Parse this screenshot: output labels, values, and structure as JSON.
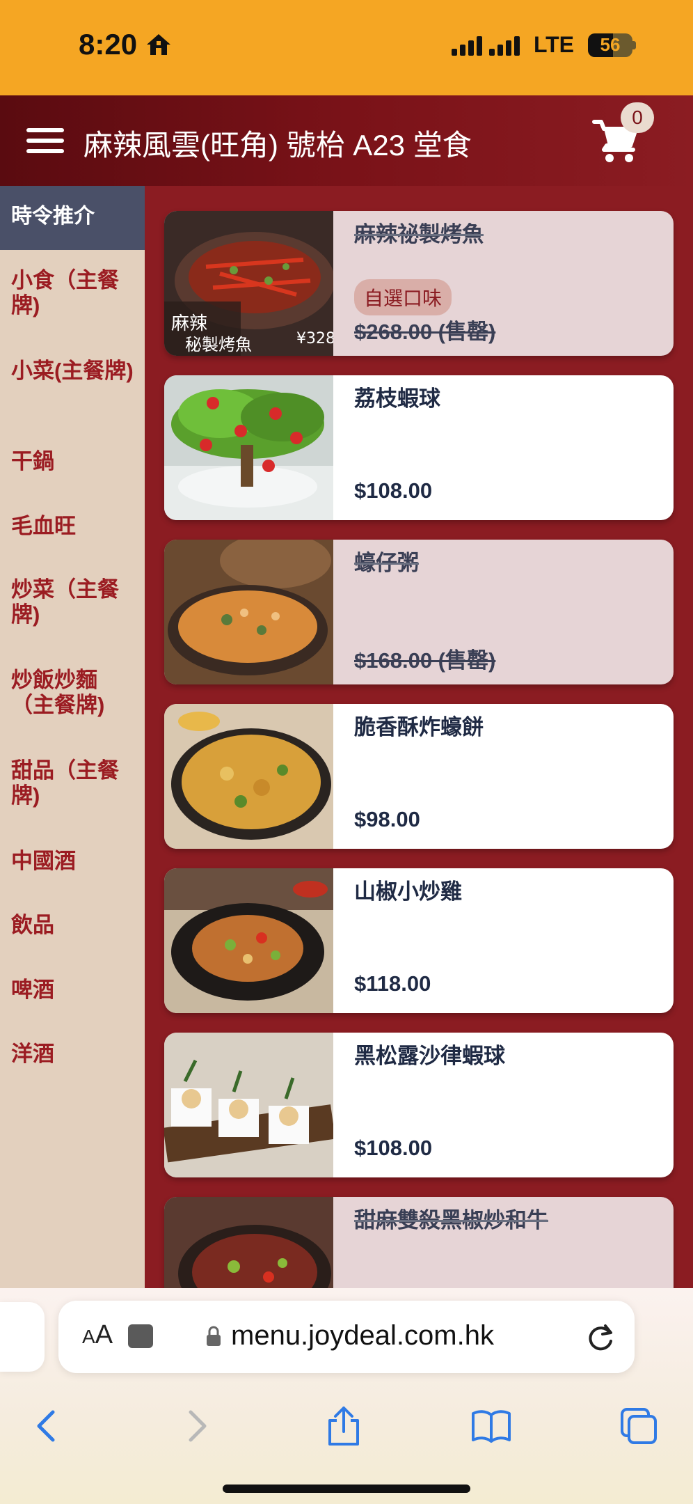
{
  "status_bar": {
    "time": "8:20",
    "network": "LTE",
    "battery": "56",
    "icons": [
      "home-icon",
      "signal-icon",
      "battery-icon"
    ]
  },
  "header": {
    "title": "麻辣風雲(旺角) 號枱 A23 堂食",
    "cart_count": "0",
    "icons": [
      "menu-icon",
      "cart-icon"
    ]
  },
  "sidebar": {
    "items": [
      {
        "label": "時令推介"
      },
      {
        "label": "小食（主餐牌)"
      },
      {
        "label": "小菜(主餐牌)"
      },
      {
        "label": "干鍋"
      },
      {
        "label": "毛血旺"
      },
      {
        "label": "炒菜（主餐牌)"
      },
      {
        "label": "炒飯炒麵（主餐牌)"
      },
      {
        "label": "甜品（主餐牌)"
      },
      {
        "label": "中國酒"
      },
      {
        "label": "飲品"
      },
      {
        "label": "啤酒"
      },
      {
        "label": "洋酒"
      }
    ]
  },
  "menu": {
    "items": [
      {
        "name": "麻辣祕製烤魚",
        "price": "$268.00 (售罄)",
        "tag": "自選口味",
        "sold_out": true
      },
      {
        "name": "荔枝蝦球",
        "price": "$108.00",
        "sold_out": false
      },
      {
        "name": "蠔仔粥",
        "price": "$168.00 (售罄)",
        "sold_out": true
      },
      {
        "name": "脆香酥炸蠔餅",
        "price": "$98.00",
        "sold_out": false
      },
      {
        "name": "山椒小炒雞",
        "price": "$118.00",
        "sold_out": false
      },
      {
        "name": "黑松露沙律蝦球",
        "price": "$108.00",
        "sold_out": false
      },
      {
        "name": "甜麻雙殺黑椒炒和牛",
        "price": "",
        "sold_out": true
      }
    ]
  },
  "browser": {
    "text_size_label_small": "A",
    "text_size_label_large": "A",
    "url": "menu.joydeal.com.hk",
    "icons": [
      "extension-icon",
      "lock-icon",
      "reload-icon",
      "back-icon",
      "forward-icon",
      "share-icon",
      "bookmarks-icon",
      "tabs-icon"
    ]
  },
  "colors": {
    "status_bar": "#f5a623",
    "header": "#7a1218",
    "page_bg": "#8b1c22",
    "sidebar_bg": "#e3d0be",
    "sidebar_active": "#4a5068",
    "sidebar_text": "#9b1c22",
    "sold_card": "#e6d4d6",
    "price_text": "#1f2a44",
    "browser_accent": "#2f7ae5"
  }
}
